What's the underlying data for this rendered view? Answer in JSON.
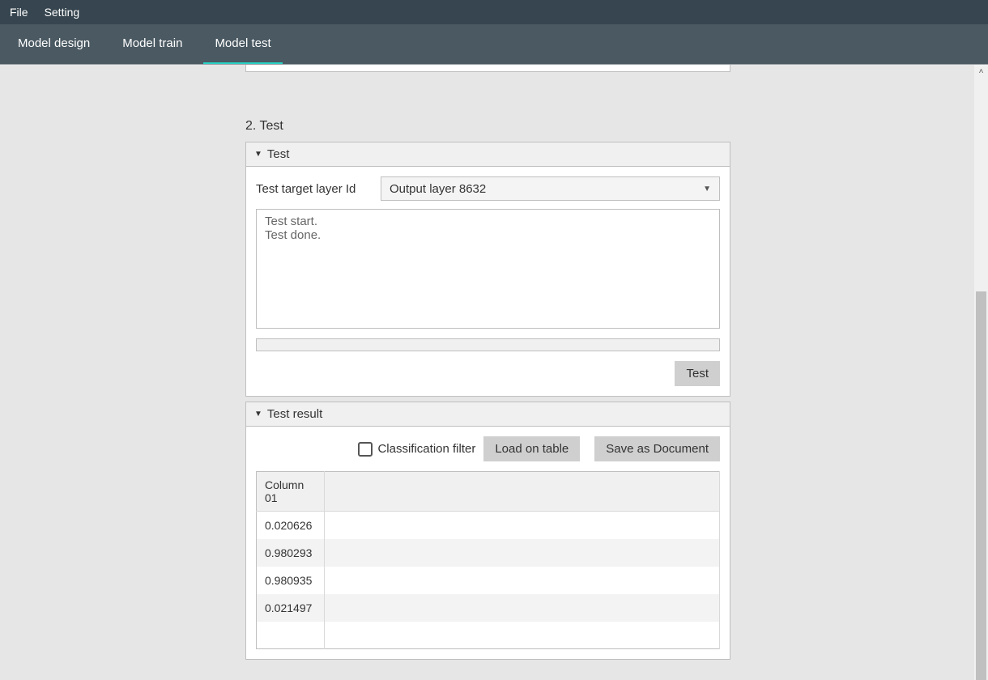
{
  "menubar": {
    "file": "File",
    "setting": "Setting"
  },
  "tabs": {
    "design": "Model design",
    "train": "Model train",
    "test": "Model test"
  },
  "section": {
    "title": "2. Test"
  },
  "test_panel": {
    "header": "Test",
    "target_label": "Test target layer Id",
    "target_value": "Output layer 8632",
    "log_line1": "Test start.",
    "log_line2": "Test done.",
    "test_button": "Test"
  },
  "result_panel": {
    "header": "Test result",
    "classification_filter": "Classification filter",
    "load_on_table": "Load on table",
    "save_as_document": "Save as Document",
    "column_header": "Column 01",
    "rows": {
      "0": "0.020626",
      "1": "0.980293",
      "2": "0.980935",
      "3": "0.021497"
    }
  }
}
